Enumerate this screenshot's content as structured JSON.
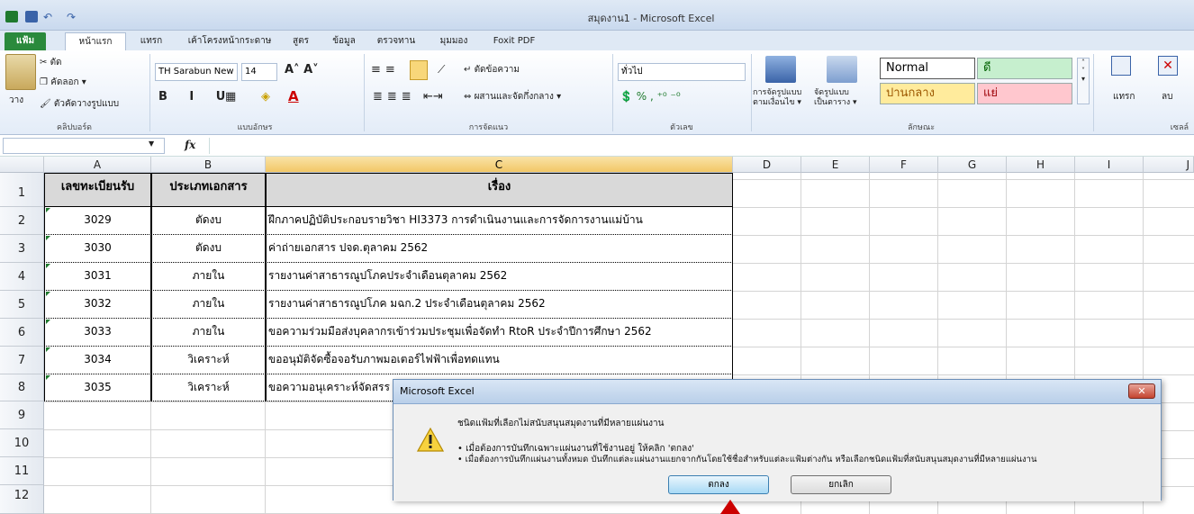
{
  "window": {
    "title": "สมุดงาน1  -  Microsoft Excel"
  },
  "tabs": [
    "แฟ้ม",
    "หน้าแรก",
    "แทรก",
    "เค้าโครงหน้ากระดาษ",
    "สูตร",
    "ข้อมูล",
    "ตรวจทาน",
    "มุมมอง",
    "Foxit PDF"
  ],
  "ribbon": {
    "clipboard": {
      "paste": "วาง",
      "cut": "ตัด",
      "copy": "คัดลอก ▾",
      "format_painter": "ตัวคัดวางรูปแบบ",
      "label": "คลิปบอร์ด"
    },
    "font": {
      "name": "TH Sarabun New",
      "size": "14",
      "label": "แบบอักษร"
    },
    "alignment": {
      "wrap": "ตัดข้อความ",
      "merge": "ผสานและจัดกึ่งกลาง ▾",
      "label": "การจัดแนว"
    },
    "number": {
      "format": "ทั่วไป",
      "label": "ตัวเลข"
    },
    "styles": {
      "cond_fmt": "การจัดรูปแบบ\nตามเงื่อนไข ▾",
      "fmt_table": "จัดรูปแบบ\nเป็นตาราง ▾",
      "normal": "Normal",
      "good": "ดี",
      "neutral": "ปานกลาง",
      "bad": "แย่",
      "label": "ลักษณะ"
    },
    "cells": {
      "insert": "แทรก",
      "delete": "ลบ",
      "label": "เซลล์"
    }
  },
  "formula_bar": {
    "fx": "fx"
  },
  "sheet": {
    "columns": [
      "A",
      "B",
      "C",
      "D",
      "E",
      "F",
      "G",
      "H",
      "I",
      "J"
    ],
    "header": [
      "เลขทะเบียนรับ",
      "ประเภทเอกสาร",
      "เรื่อง"
    ],
    "rows": [
      [
        "3029",
        "ตัดงบ",
        "ฝึกภาคปฏิบัติประกอบรายวิชา HI3373 การดำเนินงานและการจัดการงานแม่บ้าน"
      ],
      [
        "3030",
        "ตัดงบ",
        "ค่าถ่ายเอกสาร ปจด.ตุลาคม 2562"
      ],
      [
        "3031",
        "ภายใน",
        "รายงานค่าสาธารณูปโภคประจำเดือนตุลาคม 2562"
      ],
      [
        "3032",
        "ภายใน",
        "รายงานค่าสาธารณูปโภค มฉก.2 ประจำเดือนตุลาคม 2562"
      ],
      [
        "3033",
        "ภายใน",
        "ขอความร่วมมือส่งบุคลากรเข้าร่วมประชุมเพื่อจัดทำ RtoR ประจำปีการศึกษา 2562"
      ],
      [
        "3034",
        "วิเคราะห์",
        "ขออนุมัติจัดซื้อจอรับภาพมอเตอร์ไฟฟ้าเพื่อทดแทน"
      ],
      [
        "3035",
        "วิเคราะห์",
        "ขอความอนุเคราะห์จัดสรร"
      ]
    ],
    "row_numbers": [
      "1",
      "2",
      "3",
      "4",
      "5",
      "6",
      "7",
      "8",
      "9",
      "10",
      "11",
      "12"
    ]
  },
  "dialog": {
    "title": "Microsoft Excel",
    "close": "✕",
    "message": "ชนิดแฟ้มที่เลือกไม่สนับสนุนสมุดงานที่มีหลายแผ่นงาน",
    "bullet1": "• เมื่อต้องการบันทึกเฉพาะแผ่นงานที่ใช้งานอยู่ ให้คลิก 'ตกลง'",
    "bullet2": "• เมื่อต้องการบันทึกแผ่นงานทั้งหมด บันทึกแต่ละแผ่นงานแยกจากกันโดยใช้ชื่อสำหรับแต่ละแฟ้มต่างกัน หรือเลือกชนิดแฟ้มที่สนับสนุนสมุดงานที่มีหลายแผ่นงาน",
    "ok": "ตกลง",
    "cancel": "ยกเลิก"
  }
}
